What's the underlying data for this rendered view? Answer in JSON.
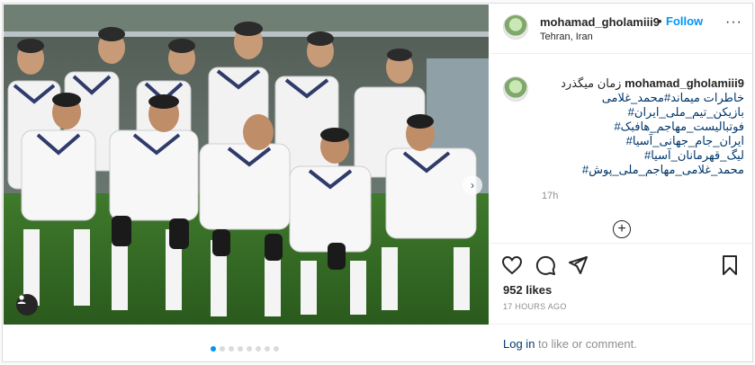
{
  "post": {
    "username": "mohamad_gholamiii9",
    "follow_label": "Follow",
    "separator": "•",
    "location": "Tehran, Iran",
    "more_label": "···",
    "photo_slides": 8,
    "active_slide": 0
  },
  "caption": {
    "username": "mohamad_gholamiii9",
    "lines": [
      "زمان میگذرد",
      "خاطرات میماند#محمد_غلامی",
      "بازیکن_تیم_ملی_ایران#",
      "فوتبالیست_مهاجم_هافبک#",
      "ایران_جام_جهانی_آسیا#",
      "لیگ_قهرمانان_آسیا#",
      "محمد_غلامی_مهاجم_ملی_پوش#"
    ],
    "time": "17h"
  },
  "icons": {
    "user_tag": "user-tag-icon",
    "next": "chevron-right-icon",
    "load_more": "plus-circle-icon",
    "like": "heart-icon",
    "comment": "comment-icon",
    "share": "share-icon",
    "save": "bookmark-icon"
  },
  "engagement": {
    "likes": "952 likes",
    "timestamp": "17 HOURS AGO"
  },
  "login": {
    "link": "Log in",
    "rest": " to like or comment."
  },
  "colors": {
    "accent": "#0095f6",
    "link": "#00376b",
    "muted": "#8e8e8e",
    "border": "#dbdbdb"
  }
}
